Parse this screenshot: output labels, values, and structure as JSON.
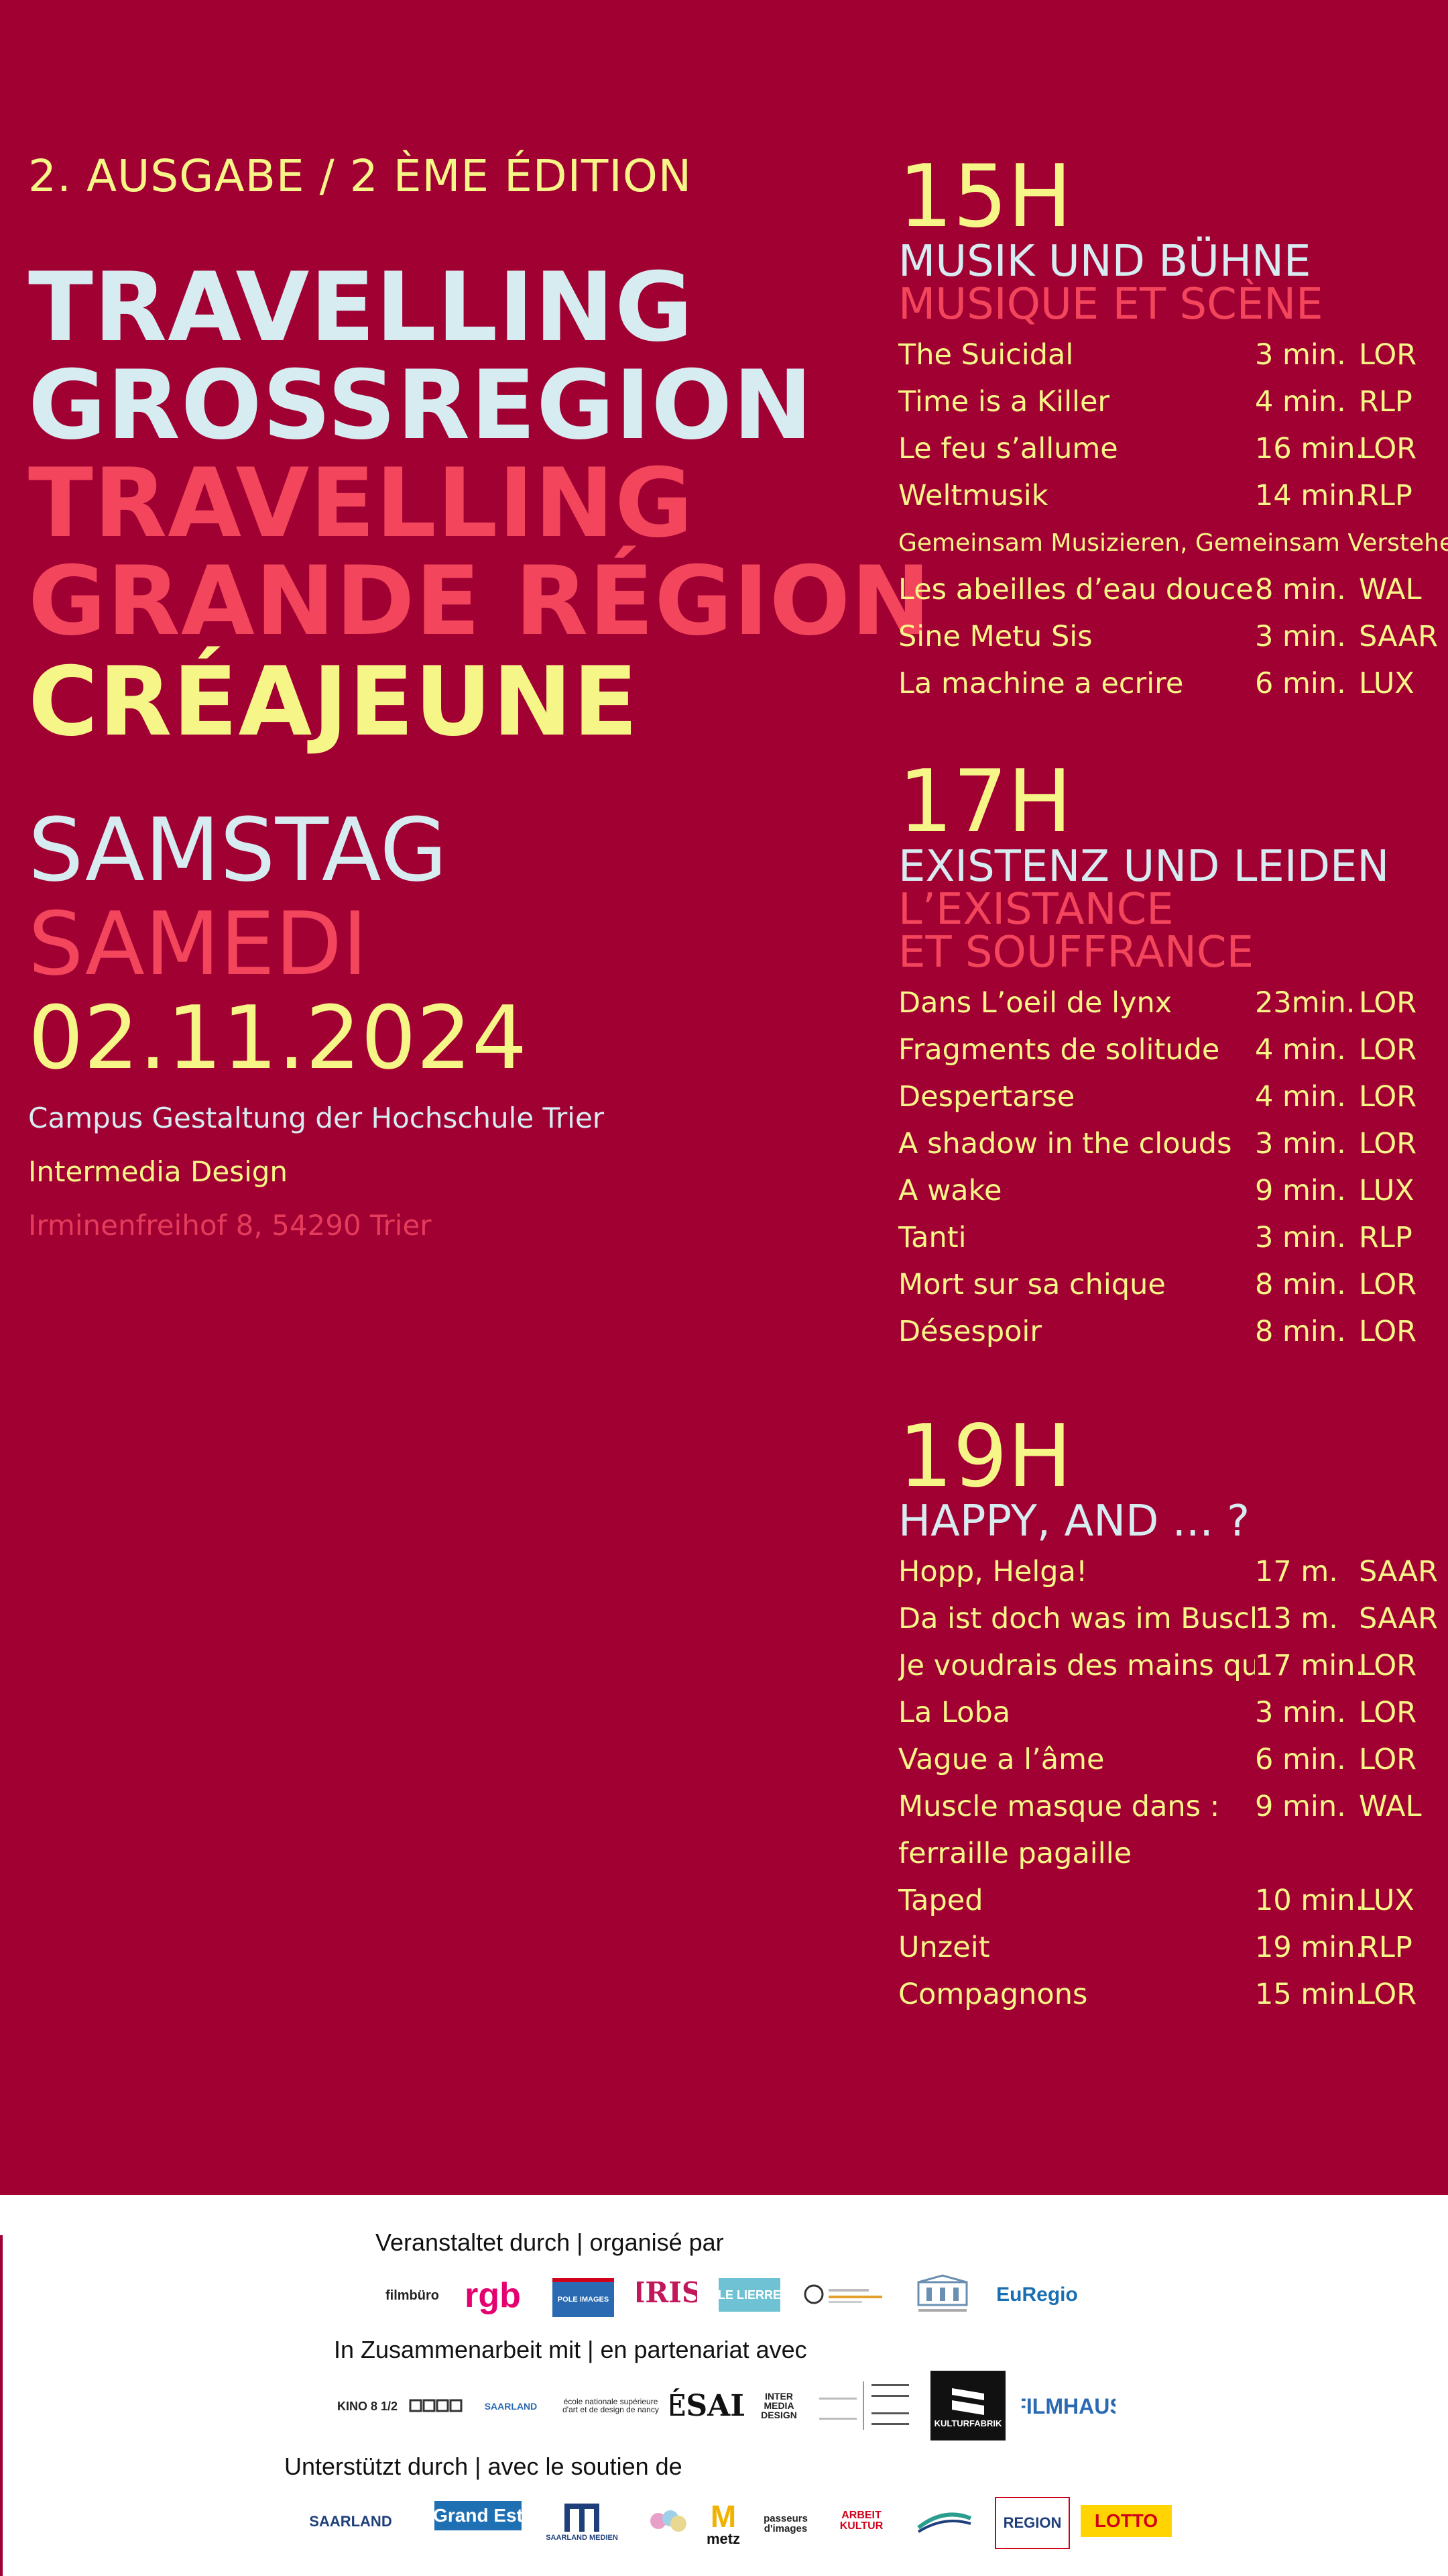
{
  "header": {
    "edition": "2. AUSGABE  / 2 ÈME ÉDITION",
    "title_de_1": "TRAVELLING",
    "title_de_2": "GROSSREGION",
    "title_fr_1": "TRAVELLING",
    "title_fr_2": "GRANDE RÉGION",
    "title_3": "CRÉAJEUNE"
  },
  "date": {
    "day_de": "SAMSTAG",
    "day_fr": "SAMEDI",
    "date": "02.11.2024"
  },
  "venue": {
    "line1": "Campus Gestaltung der Hochschule Trier",
    "line2": "Intermedia Design",
    "line3": "Irminenfreihof 8, 54290 Trier"
  },
  "blocks": [
    {
      "time": "15H",
      "title_de": "MUSIK UND BÜHNE",
      "title_fr": "MUSIQUE ET SCÈNE",
      "films": [
        {
          "title": "The Suicidal",
          "duration": "3 min.",
          "region": "LOR"
        },
        {
          "title": "Time is a Killer",
          "duration": "4 min.",
          "region": "RLP"
        },
        {
          "title": "Le feu s’allume",
          "duration": "16 min.",
          "region": "LOR"
        },
        {
          "title": "Weltmusik",
          "duration": "14 min.",
          "region": "RLP"
        }
      ],
      "note": "Gemeinsam Musizieren, Gemeinsam Verstehen",
      "films2": [
        {
          "title": "Les abeilles d’eau douce",
          "duration": "8 min.",
          "region": "WAL"
        },
        {
          "title": "Sine Metu Sis",
          "duration": "3 min.",
          "region": "SAAR"
        },
        {
          "title": "La machine a ecrire",
          "duration": "6 min.",
          "region": "LUX"
        }
      ]
    },
    {
      "time": "17H",
      "title_de": "EXISTENZ UND LEIDEN",
      "title_fr_1": "L’EXISTANCE",
      "title_fr_2": "ET SOUFFRANCE",
      "films": [
        {
          "title": "Dans L’oeil de lynx",
          "duration": "23min.",
          "region": "LOR"
        },
        {
          "title": "Fragments de solitude",
          "duration": "4 min.",
          "region": "LOR"
        },
        {
          "title": "Despertarse",
          "duration": "4 min.",
          "region": "LOR"
        },
        {
          "title": "A shadow in the clouds",
          "duration": "3 min.",
          "region": "LOR"
        },
        {
          "title": "A wake",
          "duration": "9 min.",
          "region": "LUX"
        },
        {
          "title": "Tanti",
          "duration": "3 min.",
          "region": "RLP"
        },
        {
          "title": "Mort sur sa chique",
          "duration": "8 min.",
          "region": "LOR"
        },
        {
          "title": "Désespoir",
          "duration": "8 min.",
          "region": "LOR"
        }
      ]
    },
    {
      "time": "19H",
      "title_de": "HAPPY, AND ... ?",
      "films": [
        {
          "title": "Hopp, Helga!",
          "duration": "17 m.",
          "region": "SAAR"
        },
        {
          "title": "Da ist doch was im Busch",
          "duration": "13 m.",
          "region": "SAAR"
        },
        {
          "title": "Je voudrais des mains qui",
          "duration": "17 min.",
          "region": "LOR"
        },
        {
          "title": "La Loba",
          "duration": "3 min.",
          "region": "LOR"
        },
        {
          "title": "Vague a l’âme",
          "duration": "6 min.",
          "region": "LOR"
        },
        {
          "title": "Muscle masque dans :",
          "duration": "9 min.",
          "region": "WAL"
        },
        {
          "title": "ferraille pagaille",
          "duration": "",
          "region": ""
        },
        {
          "title": "Taped",
          "duration": "10 min.",
          "region": "LUX"
        },
        {
          "title": "Unzeit",
          "duration": "19 min.",
          "region": "RLP"
        },
        {
          "title": "Compagnons",
          "duration": "15 min.",
          "region": "LOR"
        }
      ]
    }
  ],
  "footer": {
    "organized_label": "Veranstaltet durch |  organisé par",
    "partner_label": "In Zusammenarbeit mit | en partenariat avec",
    "support_label": "Unterstützt durch | avec le soutien de",
    "logos_row1": [
      "filmbüro",
      "rgb",
      "POLE IMAGES",
      "IRIS",
      "LE LIERRE",
      "",
      "",
      "EuRegio"
    ],
    "logos_row2": [
      "KINO 8 1/2",
      "",
      "SAARLAND",
      "école nationale supérieure d'art et de design de nancy",
      "ÉSAL",
      "INTER MEDIA DESIGN",
      "",
      "KULTURFABRIK",
      "FILMHAUS"
    ],
    "logos_row3": [
      "SAARLAND",
      "Grand Est",
      "SAARLAND MEDIEN",
      "",
      "metz",
      "passeurs d'images",
      "ARBEIT KULTUR",
      "",
      "REGION",
      "LOTTO"
    ],
    "colors": {
      "background": "#a10033",
      "light": "#d6ecf1",
      "coral": "#f3465c",
      "yellow": "#f6f587"
    }
  }
}
